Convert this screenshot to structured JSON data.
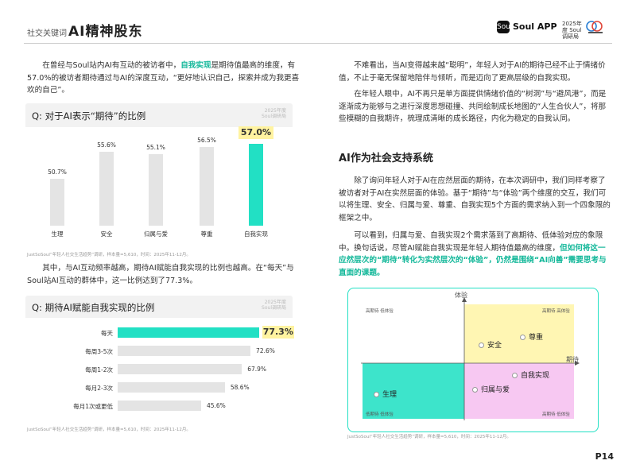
{
  "header": {
    "section_label": "社交关键词",
    "title": "AI精神股东",
    "brand": "Soul APP",
    "brand_icon": "Soul",
    "partner_logo": "2025年度 Soul调研局"
  },
  "left": {
    "para1_a": "在曾经与Soul站内AI有互动的被访者中，",
    "para1_hl": "自我实现",
    "para1_b": "是期待值最高的维度，有57.0%的被访者期待通过与AI的深度互动，“更好地认识自己，探索并成为我更喜欢的自己”。",
    "chart1": {
      "title": "Q: 对于AI表示“期待”的比例",
      "source": "JustSoSoul“年轻人社交生活趋势”调研，样本量=5,610，时间：2025年11-12月。",
      "watermark": "2025年度 Soul调研局"
    },
    "para2": "其中，与AI互动频率越高，期待AI赋能自我实现的比例也越高。在“每天”与Soul站AI互动的群体中，这一比例达到了77.3%。",
    "chart2": {
      "title": "Q: 期待AI赋能自我实现的比例",
      "source": "JustSoSoul“年轻人社交生活趋势”调研，样本量=5,610，时间：2025年11-12月。",
      "watermark": "2025年度 Soul调研局"
    }
  },
  "right": {
    "para1": "不难看出，当AI变得越来越“聪明”，年轻人对于AI的期待已经不止于情绪价值，不止于毫无保留地陪伴与倾听，而是迈向了更高层级的自我实现。",
    "para2": "在年轻人眼中，AI不再只是单方面提供情绪价值的“树洞”与“避风港”，而是逐渐成为能够与之进行深度思想碰撞、共同绘制成长地图的“人生合伙人”，将那些模糊的自我期许，梳理成清晰的成长路径，内化为稳定的自我认同。",
    "section_title": "AI作为社会支持系统",
    "para3": "除了询问年轻人对于AI在应然层面的期待，在本次调研中，我们同样考察了被访者对于AI在实然层面的体验。基于“期待”与“体验”两个维度的交互，我们可以将生理、安全、归属与爱、尊重、自我实现5个方面的需求纳入到一个四象限的框架之中。",
    "para4_a": "可以看到，归属与爱、自我实现2个需求落到了高期待、低体验对应的象限中。换句话说，尽管AI赋能自我实现是年轻人期待值最高的维度，",
    "para4_hl": "但如何将这一应然层次的“期待”转化为实然层次的“体验”，仍然是围绕“AI向善”需要思考与直面的课题。",
    "matrix": {
      "y_axis": "体验",
      "x_axis": "期待",
      "q_top_left": "高期待 低体验",
      "q_top_right": "高期待 高体验",
      "q_bottom_left": "低期待 低体验",
      "q_bottom_right": "高期待 低体验",
      "points": [
        "安全",
        "尊重",
        "自我实现",
        "归属与爱",
        "生理"
      ],
      "source": "JustSoSoul“年轻人社交生活趋势”调研，样本量=5,610，时间：2025年11-12月。"
    }
  },
  "page_number": "P14",
  "chart_data": [
    {
      "type": "bar",
      "title": "Q: 对于AI表示“期待”的比例",
      "categories": [
        "生理",
        "安全",
        "归属与爱",
        "尊重",
        "自我实现"
      ],
      "values": [
        50.7,
        55.6,
        55.1,
        56.5,
        57.0
      ],
      "labels": [
        "50.7%",
        "55.6%",
        "55.1%",
        "56.5%",
        "57.0%"
      ],
      "ylim": [
        48,
        58
      ],
      "highlight": "自我实现",
      "colors": {
        "bar": "#e4e4e4",
        "highlight": "#22e0c4",
        "callout": "#fff3a0"
      }
    },
    {
      "type": "bar",
      "orientation": "horizontal",
      "title": "Q: 期待AI赋能自我实现的比例",
      "categories": [
        "每天",
        "每周3-5次",
        "每周1-2次",
        "每月2-3次",
        "每月1次或更低"
      ],
      "values": [
        77.3,
        72.6,
        67.9,
        58.6,
        45.6
      ],
      "labels": [
        "77.3%",
        "72.6%",
        "67.9%",
        "58.6%",
        "45.6%"
      ],
      "xlim": [
        0,
        100
      ],
      "highlight": "每天",
      "colors": {
        "bar": "#e4e4e4",
        "highlight": "#22e0c4",
        "callout": "#fff3a0"
      }
    }
  ]
}
